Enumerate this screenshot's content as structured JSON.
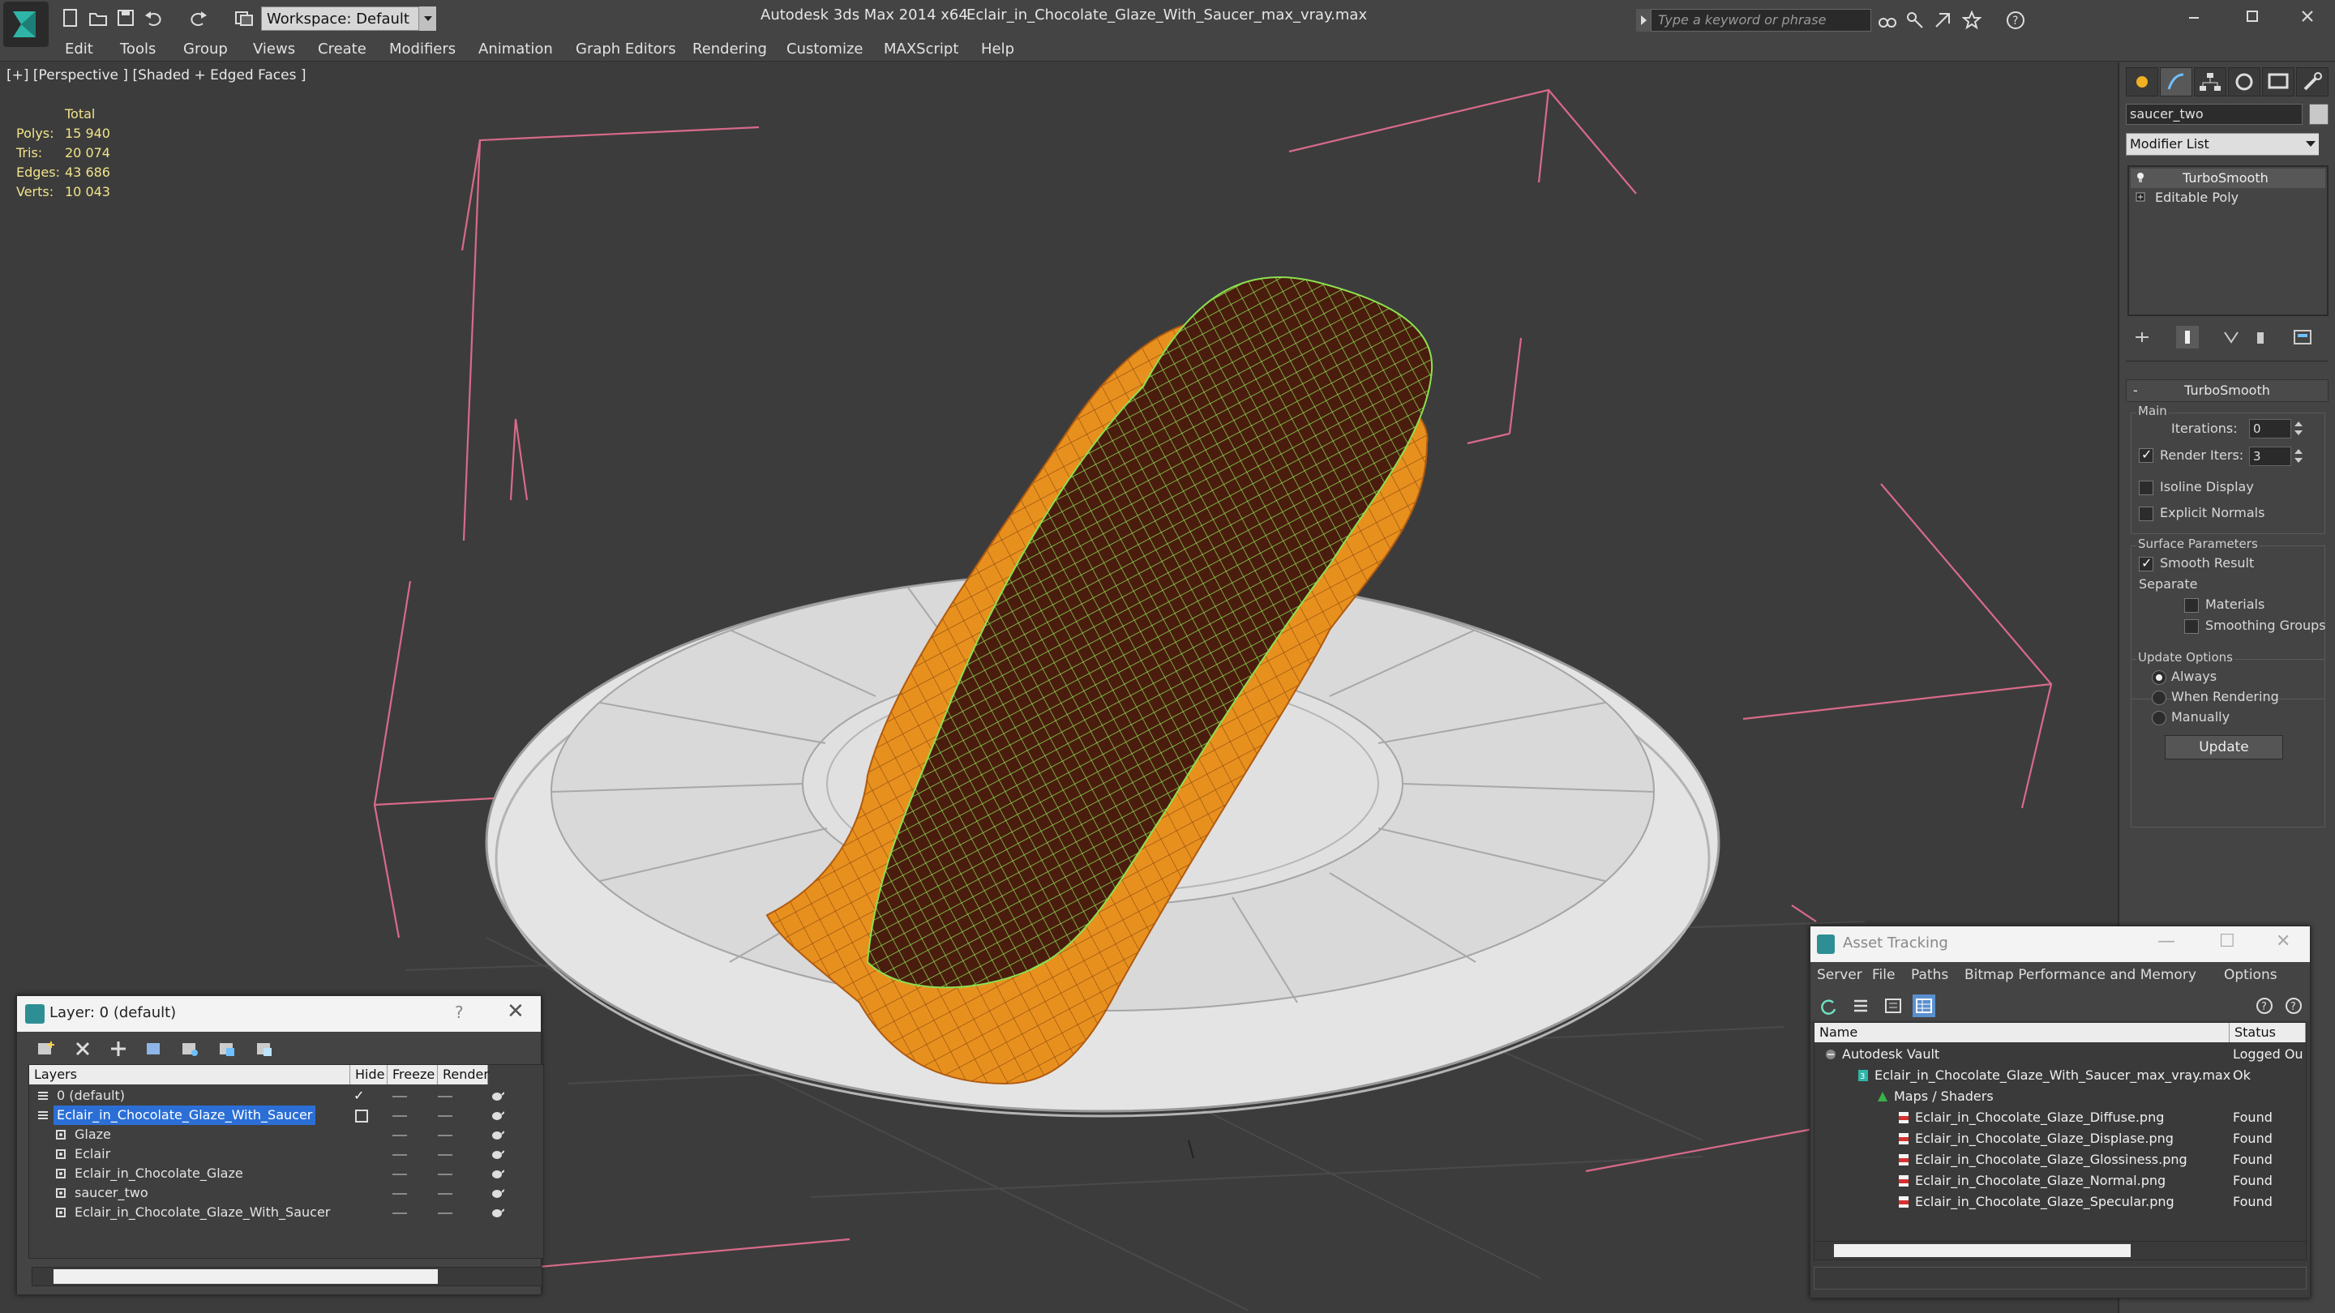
{
  "titlebar": {
    "workspace": "Workspace: Default",
    "app_title": "Autodesk 3ds Max  2014 x64",
    "file_title": "Eclair_in_Chocolate_Glaze_With_Saucer_max_vray.max",
    "search_placeholder": "Type a keyword or phrase"
  },
  "menu": [
    "Edit",
    "Tools",
    "Group",
    "Views",
    "Create",
    "Modifiers",
    "Animation",
    "Graph Editors",
    "Rendering",
    "Customize",
    "MAXScript",
    "Help"
  ],
  "viewport": {
    "label": "[+] [Perspective ] [Shaded + Edged Faces ]",
    "stats": {
      "header": "Total",
      "rows": [
        {
          "label": "Polys:",
          "value": "15 940"
        },
        {
          "label": "Tris:",
          "value": "20 074"
        },
        {
          "label": "Edges:",
          "value": "43 686"
        },
        {
          "label": "Verts:",
          "value": "10 043"
        }
      ]
    }
  },
  "command_panel": {
    "object_name": "saucer_two",
    "modifier_list": "Modifier List",
    "stack": [
      "TurboSmooth",
      "Editable Poly"
    ],
    "rollout_title": "TurboSmooth",
    "main_group": "Main",
    "iterations_label": "Iterations:",
    "iterations_value": "0",
    "render_iters_label": "Render Iters:",
    "render_iters_value": "3",
    "render_iters_checked": true,
    "isoline_label": "Isoline Display",
    "explicit_normals_label": "Explicit Normals",
    "surface_group": "Surface Parameters",
    "smooth_result_label": "Smooth Result",
    "separate_label": "Separate",
    "materials_label": "Materials",
    "smoothing_groups_label": "Smoothing Groups",
    "update_group": "Update Options",
    "always_label": "Always",
    "when_rendering_label": "When Rendering",
    "manually_label": "Manually",
    "update_button": "Update"
  },
  "layer_dialog": {
    "title": "Layer: 0 (default)",
    "help": "?",
    "columns": [
      "Layers",
      "Hide",
      "Freeze",
      "Render"
    ],
    "rows": [
      {
        "name": "0 (default)",
        "indent": 1,
        "kind": "layer",
        "current": true
      },
      {
        "name": "Eclair_in_Chocolate_Glaze_With_Saucer",
        "indent": 1,
        "kind": "layer",
        "selected": true
      },
      {
        "name": "Glaze",
        "indent": 2,
        "kind": "object"
      },
      {
        "name": "Eclair",
        "indent": 2,
        "kind": "object"
      },
      {
        "name": "Eclair_in_Chocolate_Glaze",
        "indent": 2,
        "kind": "object"
      },
      {
        "name": "saucer_two",
        "indent": 2,
        "kind": "object"
      },
      {
        "name": "Eclair_in_Chocolate_Glaze_With_Saucer",
        "indent": 2,
        "kind": "object"
      }
    ]
  },
  "asset_tracking": {
    "title": "Asset Tracking",
    "menu": [
      "Server",
      "File",
      "Paths",
      "Bitmap Performance and Memory",
      "Options"
    ],
    "columns": [
      "Name",
      "Status"
    ],
    "rows": [
      {
        "name": "Autodesk Vault",
        "status": "Logged Ou",
        "indent": 1,
        "icon": "vault-icon"
      },
      {
        "name": "Eclair_in_Chocolate_Glaze_With_Saucer_max_vray.max",
        "status": "Ok",
        "indent": 2,
        "icon": "max-file-icon"
      },
      {
        "name": "Maps / Shaders",
        "status": "",
        "indent": 3,
        "icon": "maps-icon"
      },
      {
        "name": "Eclair_in_Chocolate_Glaze_Diffuse.png",
        "status": "Found",
        "indent": 4,
        "icon": "png-icon"
      },
      {
        "name": "Eclair_in_Chocolate_Glaze_Displase.png",
        "status": "Found",
        "indent": 4,
        "icon": "png-icon"
      },
      {
        "name": "Eclair_in_Chocolate_Glaze_Glossiness.png",
        "status": "Found",
        "indent": 4,
        "icon": "png-icon"
      },
      {
        "name": "Eclair_in_Chocolate_Glaze_Normal.png",
        "status": "Found",
        "indent": 4,
        "icon": "png-icon"
      },
      {
        "name": "Eclair_in_Chocolate_Glaze_Specular.png",
        "status": "Found",
        "indent": 4,
        "icon": "png-icon"
      }
    ]
  },
  "colors": {
    "accent_selection": "#2b6fd6",
    "stats_text": "#f2e48a",
    "eclair_orange": "#e8901e",
    "glaze_wire": "#8be04e",
    "bbox_pink": "#d86a8a"
  }
}
